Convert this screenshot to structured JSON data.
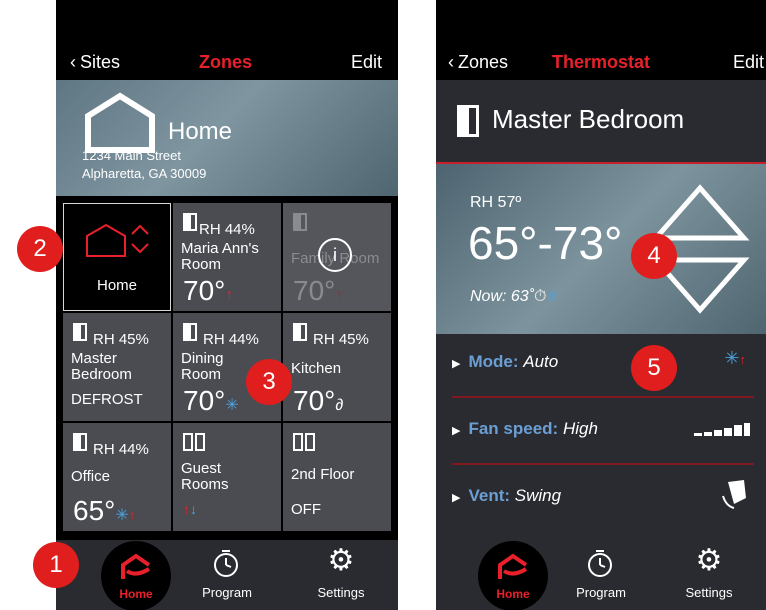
{
  "colors": {
    "accent_red": "#e8202a",
    "cool_blue": "#4aa3e0",
    "tile_gray": "#4b4c52",
    "bg_dark": "#2a2b30"
  },
  "left": {
    "nav": {
      "back": "Sites",
      "title": "Zones",
      "edit": "Edit"
    },
    "site": {
      "name": "Home",
      "address1": "1234 Main Street",
      "address2": "Alpharetta, GA 30009"
    },
    "tiles": [
      {
        "name": "Home",
        "icon": "house-icon"
      },
      {
        "rh": "RH 44%",
        "name": "Maria Ann's\nRoom",
        "temp": "70°",
        "mode": "heat"
      },
      {
        "name": "Family Room",
        "temp": "70°",
        "mode": "heat",
        "disabled": true,
        "info": "i"
      },
      {
        "rh": "RH 45%",
        "name": "Master\nBedroom",
        "status": "DEFROST"
      },
      {
        "rh": "RH 44%",
        "name": "Dining\nRoom",
        "temp": "70°",
        "mode": "cool"
      },
      {
        "rh": "RH 45%",
        "name": "Kitchen",
        "temp": "70°",
        "mode": "humid"
      },
      {
        "rh": "RH 44%",
        "name": "Office",
        "temp": "65°",
        "mode": "auto"
      },
      {
        "name": "Guest\nRooms",
        "mode": "updown"
      },
      {
        "name": "2nd Floor",
        "status": "OFF"
      }
    ],
    "tabs": [
      {
        "label": "Home"
      },
      {
        "label": "Program"
      },
      {
        "label": "Settings"
      }
    ]
  },
  "right": {
    "nav": {
      "back": "Zones",
      "title": "Thermostat",
      "edit": "Edit"
    },
    "room": "Master Bedroom",
    "rh": "RH 57º",
    "range": "65°-73°",
    "now": "Now: 63˚",
    "rows": [
      {
        "label": "Mode:",
        "value": "Auto"
      },
      {
        "label": "Fan speed:",
        "value": "High"
      },
      {
        "label": "Vent:",
        "value": "Swing"
      }
    ],
    "tabs": [
      {
        "label": "Home"
      },
      {
        "label": "Program"
      },
      {
        "label": "Settings"
      }
    ]
  },
  "badges": [
    "1",
    "2",
    "3",
    "4",
    "5"
  ]
}
